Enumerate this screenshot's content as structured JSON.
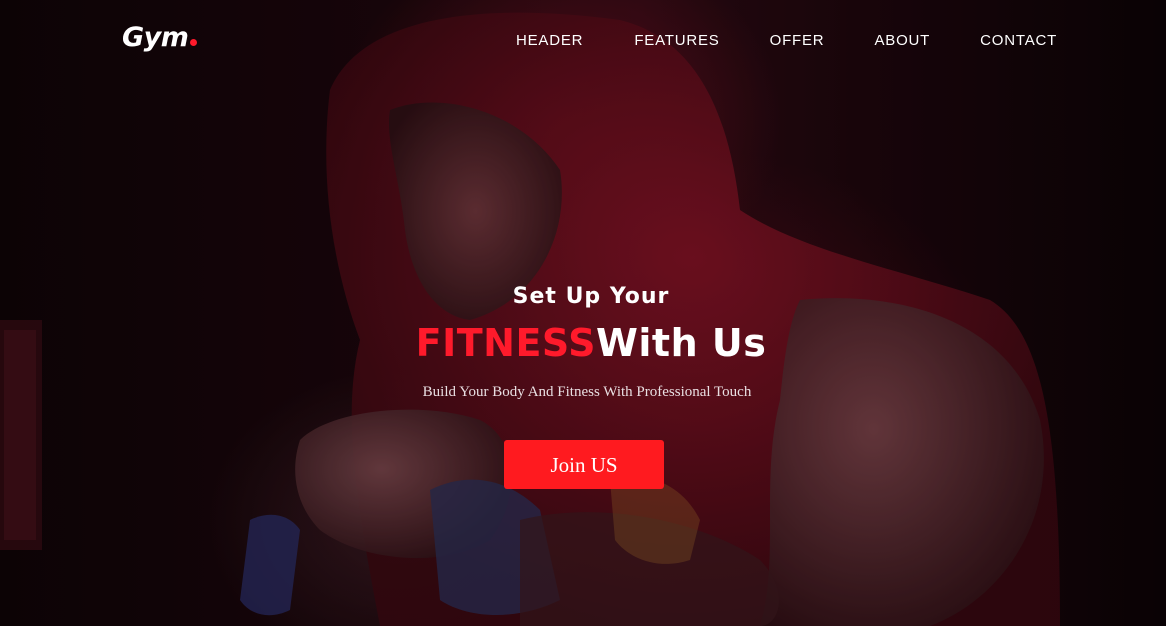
{
  "brand": {
    "name": "Gym",
    "accent_color": "#ff1a2b"
  },
  "nav": {
    "items": [
      {
        "label": "HEADER"
      },
      {
        "label": "FEATURES"
      },
      {
        "label": "OFFER"
      },
      {
        "label": "ABOUT"
      },
      {
        "label": "CONTACT"
      }
    ]
  },
  "hero": {
    "pre_title": "Set Up Your",
    "title_accent": "FITNESS",
    "title_rest": "With Us",
    "subtitle": "Build Your Body And Fitness With Professional Touch",
    "cta_label": "Join US",
    "cta_color": "#ff1a1f",
    "background_image": "hooded-boxer-photo"
  }
}
